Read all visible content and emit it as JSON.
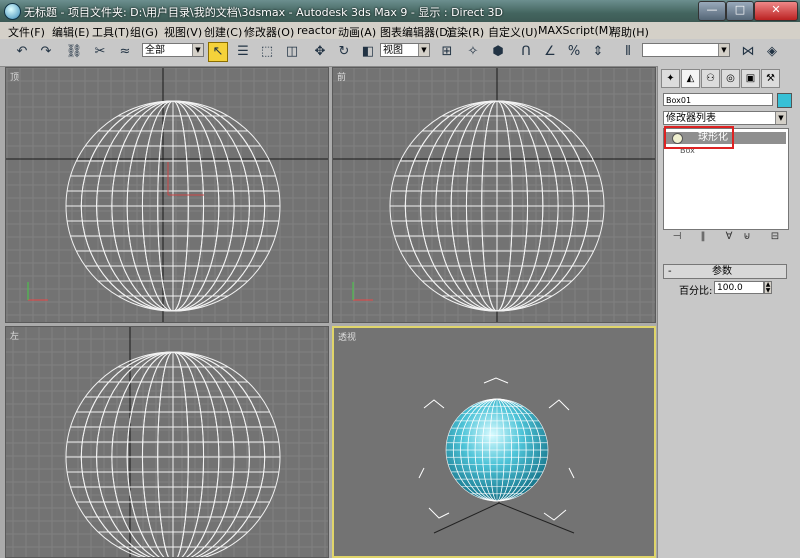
{
  "window": {
    "title": "无标题      - 项目文件夹: D:\\用户目录\\我的文档\\3dsmax      - Autodesk 3ds Max 9      - 显示 : Direct 3D",
    "btn_min": "—",
    "btn_max": "□",
    "btn_close": "✕"
  },
  "menu": [
    "文件(F)",
    "编辑(E)",
    "工具(T)",
    "组(G)",
    "视图(V)",
    "创建(C)",
    "修改器(O)",
    "reactor",
    "动画(A)",
    "图表编辑器(D)",
    "渲染(R)",
    "自定义(U)",
    "MAXScript(M)",
    "帮助(H)"
  ],
  "toolbar": {
    "selection_filter": "全部",
    "ref_coord": "视图",
    "named_selection": ""
  },
  "viewports": {
    "top": {
      "label": "顶"
    },
    "front": {
      "label": "前"
    },
    "left": {
      "label": "左"
    },
    "perspective": {
      "label": "透视"
    }
  },
  "command_panel": {
    "object_name": "Box01",
    "object_color": "#37c0d6",
    "modifier_list": "修改器列表",
    "stack": {
      "modifier": "球形化",
      "base": "Box"
    },
    "rollout": {
      "collapse": "-",
      "title": "参数"
    },
    "percent": {
      "label": "百分比:",
      "value": "100.0"
    }
  },
  "icons": {
    "tabs": [
      "create-icon",
      "modify-icon",
      "hierarchy-icon",
      "motion-icon",
      "display-icon",
      "utilities-icon"
    ]
  }
}
